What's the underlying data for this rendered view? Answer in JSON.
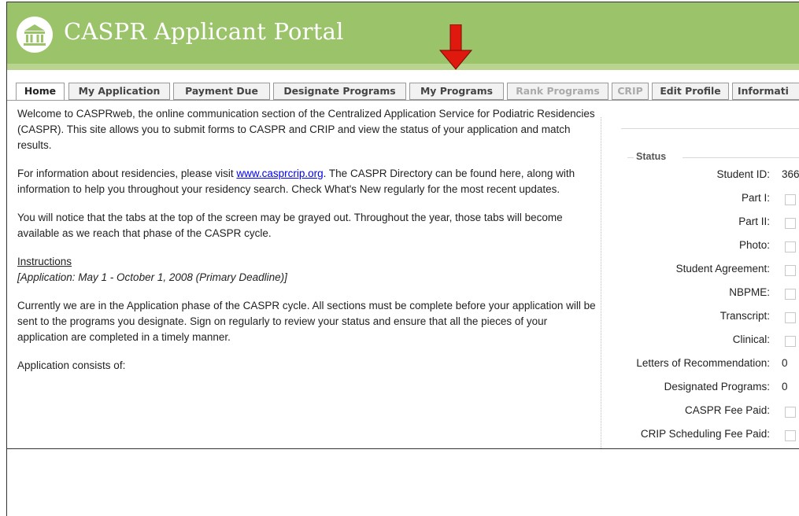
{
  "header": {
    "title": "CASPR Applicant Portal",
    "logo_icon": "pillared-building-icon",
    "accent_color": "#9ac36a"
  },
  "arrow": {
    "icon": "red-down-arrow-icon",
    "color": "#e0190f"
  },
  "tabs": [
    {
      "label": "Home",
      "state": "active"
    },
    {
      "label": "My Application",
      "state": "enabled"
    },
    {
      "label": "Payment Due",
      "state": "enabled"
    },
    {
      "label": "Designate Programs",
      "state": "enabled"
    },
    {
      "label": "My Programs",
      "state": "enabled"
    },
    {
      "label": "Rank Programs",
      "state": "disabled"
    },
    {
      "label": "CRIP",
      "state": "disabled"
    },
    {
      "label": "Edit Profile",
      "state": "enabled"
    },
    {
      "label": "Informati",
      "state": "enabled"
    }
  ],
  "main": {
    "welcome": "Welcome to CASPRweb, the online communication section of the Centralized Application Service for Podiatric Residencies (CASPR). This site allows you to submit forms to CASPR and CRIP and view the status of your application and match results.",
    "info_before_link": "For information about residencies, please visit ",
    "info_link": "www.casprcrip.org",
    "info_after_link": ". The CASPR Directory can be found here, along with information to help you throughout your residency search. Check What's New regularly for the most recent updates.",
    "notice": "You will notice that the tabs at the top of the screen may be grayed out. Throughout the year, those tabs will become available as we reach that phase of the CASPR cycle.",
    "instructions_heading": "Instructions",
    "instructions_note": "[Application: May 1 - October 1, 2008 (Primary Deadline)]",
    "phase_text": "Currently we are in the Application phase of the CASPR cycle. All sections must be complete before your application will be sent to the programs you designate. Sign on regularly to review your status and ensure that all the pieces of your application are completed in a timely manner.",
    "consists": "Application consists of:"
  },
  "status": {
    "legend": "Status",
    "rows": [
      {
        "label": "Student ID:",
        "value": "366",
        "type": "text"
      },
      {
        "label": "Part I:",
        "type": "checkbox",
        "checked": false
      },
      {
        "label": "Part II:",
        "type": "checkbox",
        "checked": false
      },
      {
        "label": "Photo:",
        "type": "checkbox",
        "checked": false
      },
      {
        "label": "Student Agreement:",
        "type": "checkbox",
        "checked": false
      },
      {
        "label": "NBPME:",
        "type": "checkbox",
        "checked": false
      },
      {
        "label": "Transcript:",
        "type": "checkbox",
        "checked": false
      },
      {
        "label": "Clinical:",
        "type": "checkbox",
        "checked": false
      },
      {
        "label": "Letters of Recommendation:",
        "value": "0",
        "type": "text"
      },
      {
        "label": "Designated Programs:",
        "value": "0",
        "type": "text"
      },
      {
        "label": "CASPR Fee Paid:",
        "type": "checkbox",
        "checked": false
      },
      {
        "label": "CRIP Scheduling Fee Paid:",
        "type": "checkbox",
        "checked": false
      }
    ]
  }
}
